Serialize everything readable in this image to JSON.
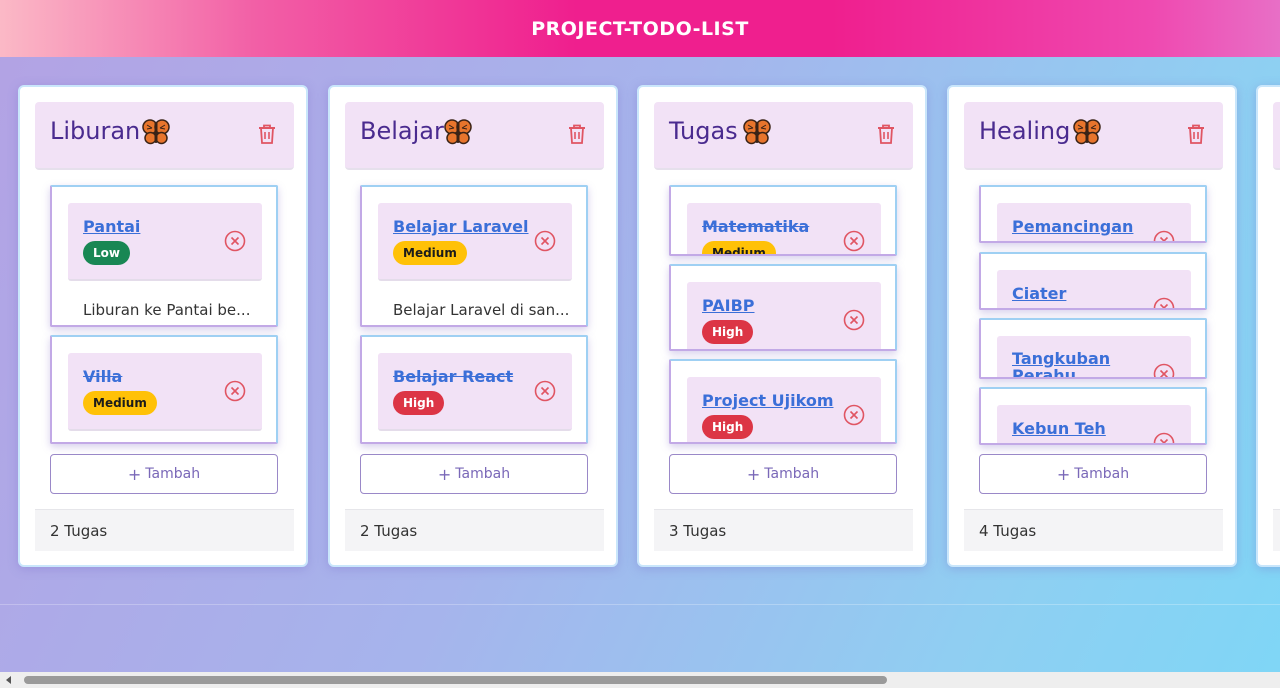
{
  "header": {
    "title": "PROJECT-TODO-LIST"
  },
  "add_label": "Tambah",
  "colors": {
    "header_pink": "#ef1f8e",
    "column_title": "#4a2b8f",
    "task_link": "#3b6fd8",
    "badge_low": "#198754",
    "badge_medium": "#ffc107",
    "badge_high": "#dc3545",
    "danger_icon": "#e05563"
  },
  "icons": {
    "column_icon": "butterfly-icon",
    "delete_column": "trash-icon",
    "delete_task": "circle-x-icon",
    "add": "plus-icon"
  },
  "columns": [
    {
      "title": "Liburan",
      "footer": "2 Tugas",
      "tasks": [
        {
          "title": "Pantai",
          "priority": "Low",
          "done": false,
          "description": "Liburan ke Pantai be..."
        },
        {
          "title": "Villa",
          "priority": "Medium",
          "done": true
        }
      ]
    },
    {
      "title": "Belajar",
      "footer": "2 Tugas",
      "tasks": [
        {
          "title": "Belajar Laravel",
          "priority": "Medium",
          "done": false,
          "description": "Belajar Laravel di san..."
        },
        {
          "title": "Belajar React",
          "priority": "High",
          "done": true
        }
      ]
    },
    {
      "title": "Tugas",
      "footer": "3 Tugas",
      "tasks": [
        {
          "title": "Matematika",
          "priority": "Medium",
          "done": true
        },
        {
          "title": "PAIBP",
          "priority": "High",
          "done": false
        },
        {
          "title": "Project Ujikom",
          "priority": "High",
          "done": false
        }
      ]
    },
    {
      "title": "Healing",
      "footer": "4 Tugas",
      "tasks": [
        {
          "title": "Pemancingan",
          "done": false
        },
        {
          "title": "Ciater",
          "done": false
        },
        {
          "title": "Tangkuban Perahu",
          "done": false
        },
        {
          "title": "Kebun Teh",
          "done": false
        }
      ]
    }
  ]
}
